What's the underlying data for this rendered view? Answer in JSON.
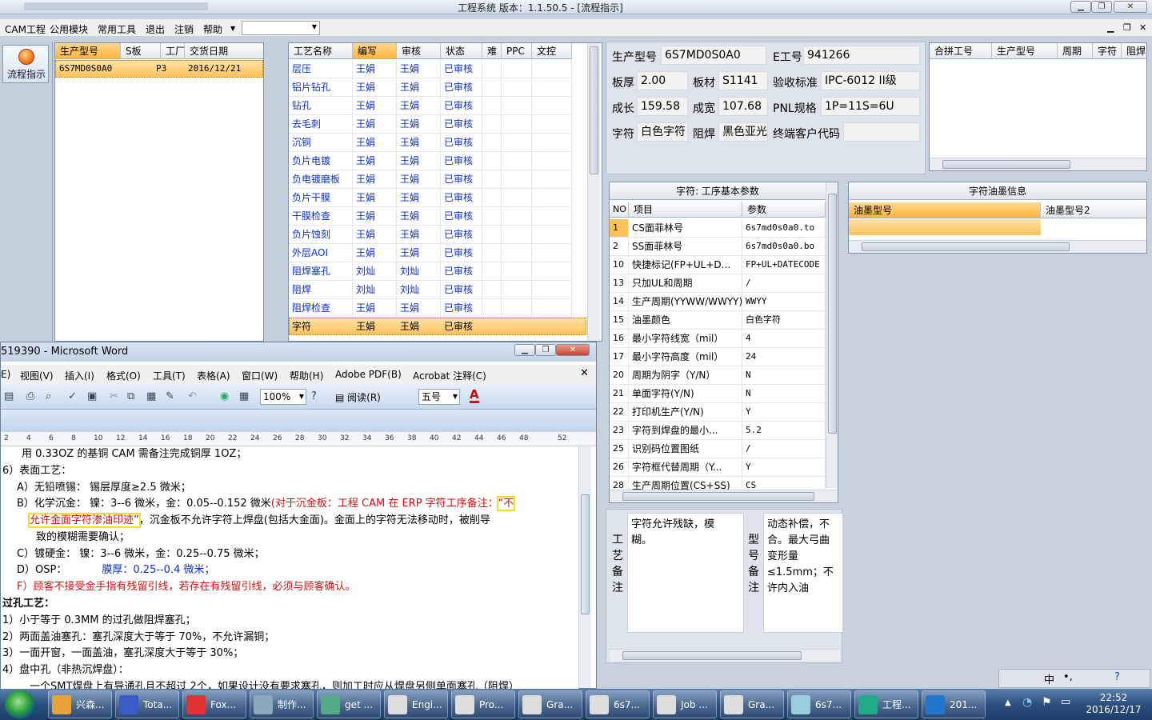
{
  "app": {
    "title": "工程系统   版本：1.1.50.5 - [流程指示]"
  },
  "menu": [
    "CAM工程",
    "公用模块",
    "常用工具",
    "退出",
    "注销",
    "帮助"
  ],
  "nav": {
    "flow_label": "流程指示"
  },
  "order_grid": {
    "headers": [
      "生产型号",
      "S板",
      "工厂",
      "交货日期"
    ],
    "rows": [
      [
        "6S7MD0S0A0",
        "",
        "P3",
        "2016/12/21"
      ]
    ]
  },
  "process_grid": {
    "headers": [
      "工艺名称",
      "编写",
      "审核",
      "状态",
      "难",
      "PPC",
      "文控"
    ],
    "rows": [
      [
        "层压",
        "王娟",
        "王娟",
        "已审核"
      ],
      [
        "铝片钻孔",
        "王娟",
        "王娟",
        "已审核"
      ],
      [
        "钻孔",
        "王娟",
        "王娟",
        "已审核"
      ],
      [
        "去毛刺",
        "王娟",
        "王娟",
        "已审核"
      ],
      [
        "沉铜",
        "王娟",
        "王娟",
        "已审核"
      ],
      [
        "负片电镀",
        "王娟",
        "王娟",
        "已审核"
      ],
      [
        "负电镀磨板",
        "王娟",
        "王娟",
        "已审核"
      ],
      [
        "负片干膜",
        "王娟",
        "王娟",
        "已审核"
      ],
      [
        "干膜检查",
        "王娟",
        "王娟",
        "已审核"
      ],
      [
        "负片蚀刻",
        "王娟",
        "王娟",
        "已审核"
      ],
      [
        "外层AOI",
        "王娟",
        "王娟",
        "已审核"
      ],
      [
        "阻焊塞孔",
        "刘灿",
        "刘灿",
        "已审核"
      ],
      [
        "阻焊",
        "刘灿",
        "刘灿",
        "已审核"
      ],
      [
        "阻焊检查",
        "王娟",
        "王娟",
        "已审核"
      ],
      [
        "字符",
        "王娟",
        "王娟",
        "已审核"
      ]
    ]
  },
  "info": {
    "model_label": "生产型号",
    "model": "6S7MD0S0A0",
    "eno_label": "E工号",
    "eno": "941266",
    "thick_label": "板厚",
    "thick": "2.00",
    "mat_label": "板材",
    "mat": "S1141",
    "std_label": "验收标准",
    "std": "IPC-6012 II级",
    "len_label": "成长",
    "len": "159.58",
    "wid_label": "成宽",
    "wid": "107.68",
    "pnl_label": "PNL规格",
    "pnl": "1P=11S=6U",
    "char_label": "字符",
    "char": "白色字符",
    "mask_label": "阻焊",
    "mask": "黑色亚光",
    "cust_label": "终端客户代码",
    "cust": ""
  },
  "merge_grid": {
    "headers": [
      "合拼工号",
      "生产型号",
      "周期",
      "字符",
      "阻焊"
    ]
  },
  "param_grid": {
    "title": "字符: 工序基本参数",
    "headers": [
      "NO",
      "项目",
      "参数"
    ],
    "rows": [
      [
        "1",
        "CS面菲林号",
        "6s7md0s0a0.to"
      ],
      [
        "2",
        "SS面菲林号",
        "6s7md0s0a0.bo"
      ],
      [
        "10",
        "快捷标记(FP+UL+D...",
        "FP+UL+DATECODE"
      ],
      [
        "13",
        "只加UL和周期",
        "/"
      ],
      [
        "14",
        "生产周期(YYWW/WWYY)",
        "WWYY"
      ],
      [
        "15",
        "油墨颜色",
        "白色字符"
      ],
      [
        "16",
        "最小字符线宽（mil）",
        "4"
      ],
      [
        "17",
        "最小字符高度（mil）",
        "24"
      ],
      [
        "20",
        "周期为阴字（Y/N）",
        "N"
      ],
      [
        "21",
        "单面字符(Y/N)",
        "N"
      ],
      [
        "22",
        "打印机生产(Y/N)",
        "Y"
      ],
      [
        "23",
        "字符到焊盘的最小...",
        "5.2"
      ],
      [
        "25",
        "识别码位置图纸",
        "/"
      ],
      [
        "26",
        "字符框代替周期（Y...",
        "Y"
      ],
      [
        "28",
        "生产周期位置(CS+SS)",
        "CS"
      ]
    ]
  },
  "ink_grid": {
    "title": "字符油墨信息",
    "headers": [
      "油墨型号",
      "油墨型号2"
    ]
  },
  "remarks": {
    "process_label": "工艺备注",
    "process_text": "字符允许残缺，模糊。",
    "type_label": "型号备注",
    "type_text": "动态补偿，不合。最大弓曲变形量≤1.5mm；不许内入油"
  },
  "word": {
    "title": "519390 - Microsoft Word",
    "menu": [
      "E)",
      "视图(V)",
      "插入(I)",
      "格式(O)",
      "工具(T)",
      "表格(A)",
      "窗口(W)",
      "帮助(H)",
      "Adobe PDF(B)",
      "Acrobat 注释(C)"
    ],
    "zoom": "100%",
    "read_label": "阅读(R)",
    "font_size": "五号",
    "ruler": [
      "2",
      "4",
      "6",
      "8",
      "10",
      "12",
      "14",
      "16",
      "18",
      "20",
      "22",
      "24",
      "26",
      "28",
      "30",
      "32",
      "34",
      "36",
      "38",
      "40",
      "42",
      "44",
      "46",
      "48",
      "52"
    ],
    "lines": [
      "用 0.33OZ 的基铜 CAM 需备注完成铜厚 1OZ；",
      "6）表面工艺：",
      "A）无铅喷锡：  锡层厚度≥2.5 微米；",
      "B）化学沉金：  镍：3--6 微米，金：0.05--0.152 微米",
      "(对于沉金板：工程 CAM 在 ERP 字符工序备注：",
      "“不",
      "允许金面字符渗油印迹”",
      "，沉金板不允许字符上焊盘(包括大金面)。金面上的字符无法移动时，被削导",
      "致的模糊需要确认；",
      "C）镀硬金：    镍：3--6 微米，金：0.25--0.75 微米；",
      "D）OSP：",
      "膜厚：0.25--0.4 微米；",
      "F）顾客不接受金手指有残留引线，若存在有残留引线，必须与顾客确认。",
      "过孔工艺：",
      "1）小于等于 0.3MM 的过孔做阻焊塞孔；",
      "2）两面盖油塞孔：塞孔深度大于等于 70%，不允许漏铜；",
      "3）一面开窗，一面盖油，塞孔深度大于等于 30%；",
      "4）盘中孔（非热沉焊盘）：",
      "一个SMT焊盘上有导通孔且不超过 2个，如果设计没有要求塞孔，则加工时应从焊盘另侧单面塞孔（阻焊）"
    ]
  },
  "taskbar": {
    "items": [
      "兴森...",
      "Tota...",
      "Fox...",
      "制作...",
      "get ...",
      "Engi...",
      "Pro...",
      "Gra...",
      "6s7...",
      "Job ...",
      "Gra...",
      "6s7...",
      "工程...",
      "201..."
    ],
    "time": "22:52",
    "date": "2016/12/17"
  },
  "colors": {
    "selection": "#fbc25a",
    "link_blue": "#1030c0",
    "red": "#d01010",
    "highlight_box": "#f2e11a"
  }
}
